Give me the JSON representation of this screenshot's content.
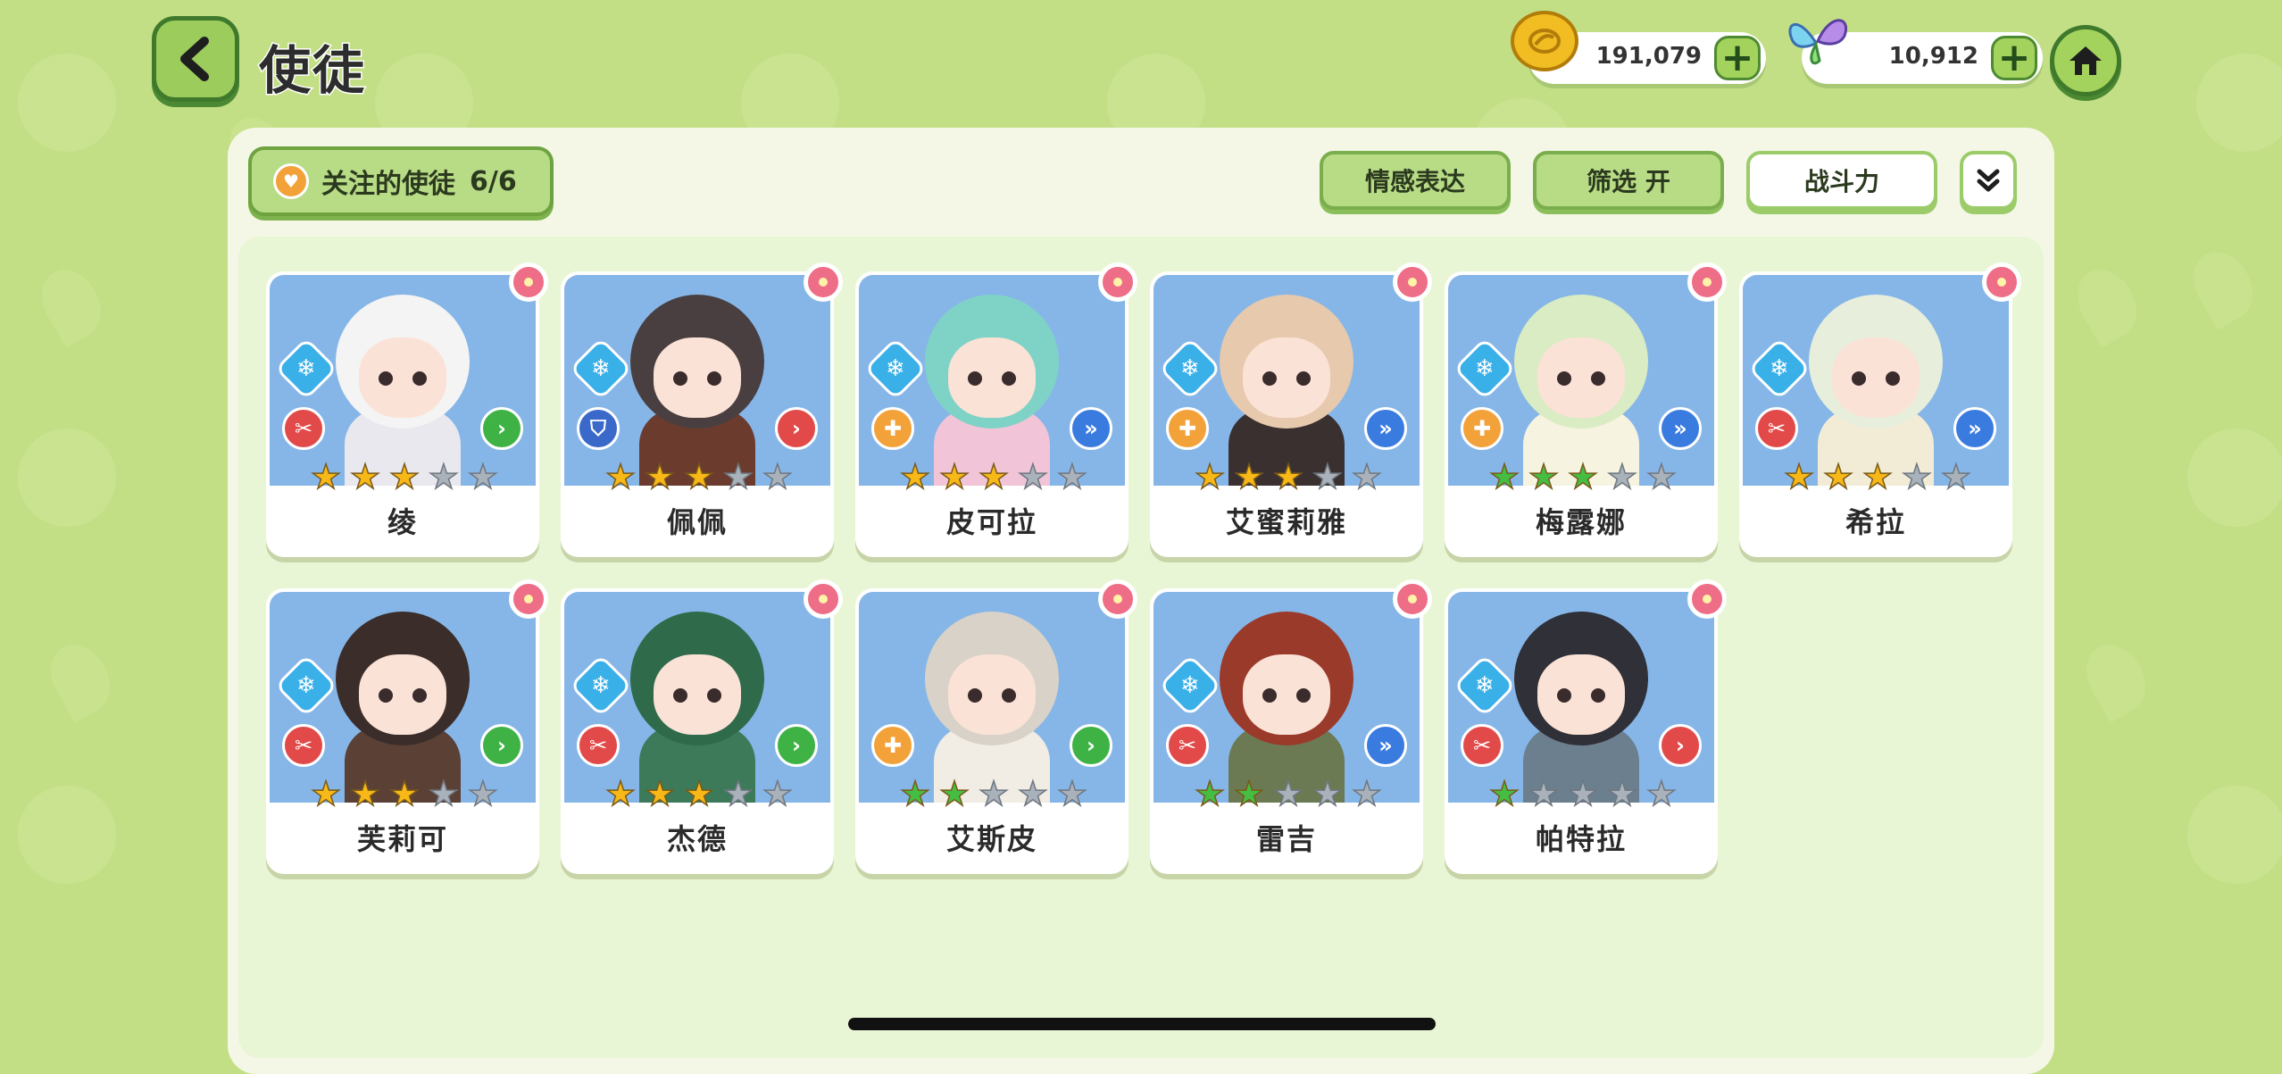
{
  "header": {
    "title": "使徒",
    "back_icon": "chevron-left-icon",
    "home_icon": "home-icon"
  },
  "currencies": [
    {
      "icon": "gold-coin-icon",
      "amount": "191,079",
      "plus": "+"
    },
    {
      "icon": "butterfly-icon",
      "amount": "10,912",
      "plus": "+"
    }
  ],
  "toolbar": {
    "favorites_label": "关注的使徒",
    "favorites_count": "6/6",
    "emotion_label": "情感表达",
    "filter_label": "筛选 开",
    "sort_label": "战斗力",
    "expand_icon": "double-chevron-down-icon"
  },
  "characters": [
    {
      "name": "绫",
      "stars": 3,
      "star_color": "gold",
      "element": "ice",
      "role": "attacker",
      "speed": "fast",
      "hair": "#f4f4f4",
      "outfit": "#e8e8ee"
    },
    {
      "name": "佩佩",
      "stars": 3,
      "star_color": "gold",
      "element": "ice",
      "role": "defender",
      "speed": "normal",
      "hair": "#4a3f40",
      "outfit": "#6b3b2e"
    },
    {
      "name": "皮可拉",
      "stars": 3,
      "star_color": "gold",
      "element": "ice",
      "role": "healer",
      "speed": "very-fast",
      "hair": "#7fd3c6",
      "outfit": "#f2c4d8"
    },
    {
      "name": "艾蜜莉雅",
      "stars": 3,
      "star_color": "gold",
      "element": "ice",
      "role": "healer",
      "speed": "very-fast",
      "hair": "#e7c9ad",
      "outfit": "#3a3030"
    },
    {
      "name": "梅露娜",
      "stars": 3,
      "star_color": "green",
      "element": "ice",
      "role": "healer",
      "speed": "very-fast",
      "hair": "#d9ecc3",
      "outfit": "#f6f3e0"
    },
    {
      "name": "希拉",
      "stars": 3,
      "star_color": "gold",
      "element": "ice",
      "role": "attacker",
      "speed": "very-fast",
      "hair": "#e7eedc",
      "outfit": "#f2ecd6"
    },
    {
      "name": "芙莉可",
      "stars": 3,
      "star_color": "gold",
      "element": "ice",
      "role": "attacker",
      "speed": "fast",
      "hair": "#3b2d2a",
      "outfit": "#5a4035"
    },
    {
      "name": "杰德",
      "stars": 3,
      "star_color": "gold",
      "element": "ice",
      "role": "attacker",
      "speed": "fast",
      "hair": "#2f6a4a",
      "outfit": "#3c7a5a"
    },
    {
      "name": "艾斯皮",
      "stars": 2,
      "star_color": "green",
      "element": "none",
      "role": "healer",
      "speed": "fast",
      "hair": "#d9d2c8",
      "outfit": "#f1ece4"
    },
    {
      "name": "雷吉",
      "stars": 2,
      "star_color": "green",
      "element": "ice",
      "role": "attacker",
      "speed": "very-fast",
      "hair": "#9a3a2b",
      "outfit": "#6b7a52"
    },
    {
      "name": "帕特拉",
      "stars": 1,
      "star_color": "green",
      "element": "ice",
      "role": "attacker",
      "speed": "normal",
      "hair": "#2f3038",
      "outfit": "#6b7f8f"
    }
  ],
  "colors": {
    "background": "#c3df86",
    "card_art": "#86b6e8",
    "attacker": "#e24a4a",
    "defender": "#3b69c9",
    "healer": "#f3a23a",
    "speed_fast": "#3fb245",
    "speed_very_fast": "#3a7be0",
    "speed_normal": "#e24a4a",
    "star_gold": "#f7b818",
    "star_green": "#45bd42",
    "star_empty": "#a9b1bb"
  }
}
